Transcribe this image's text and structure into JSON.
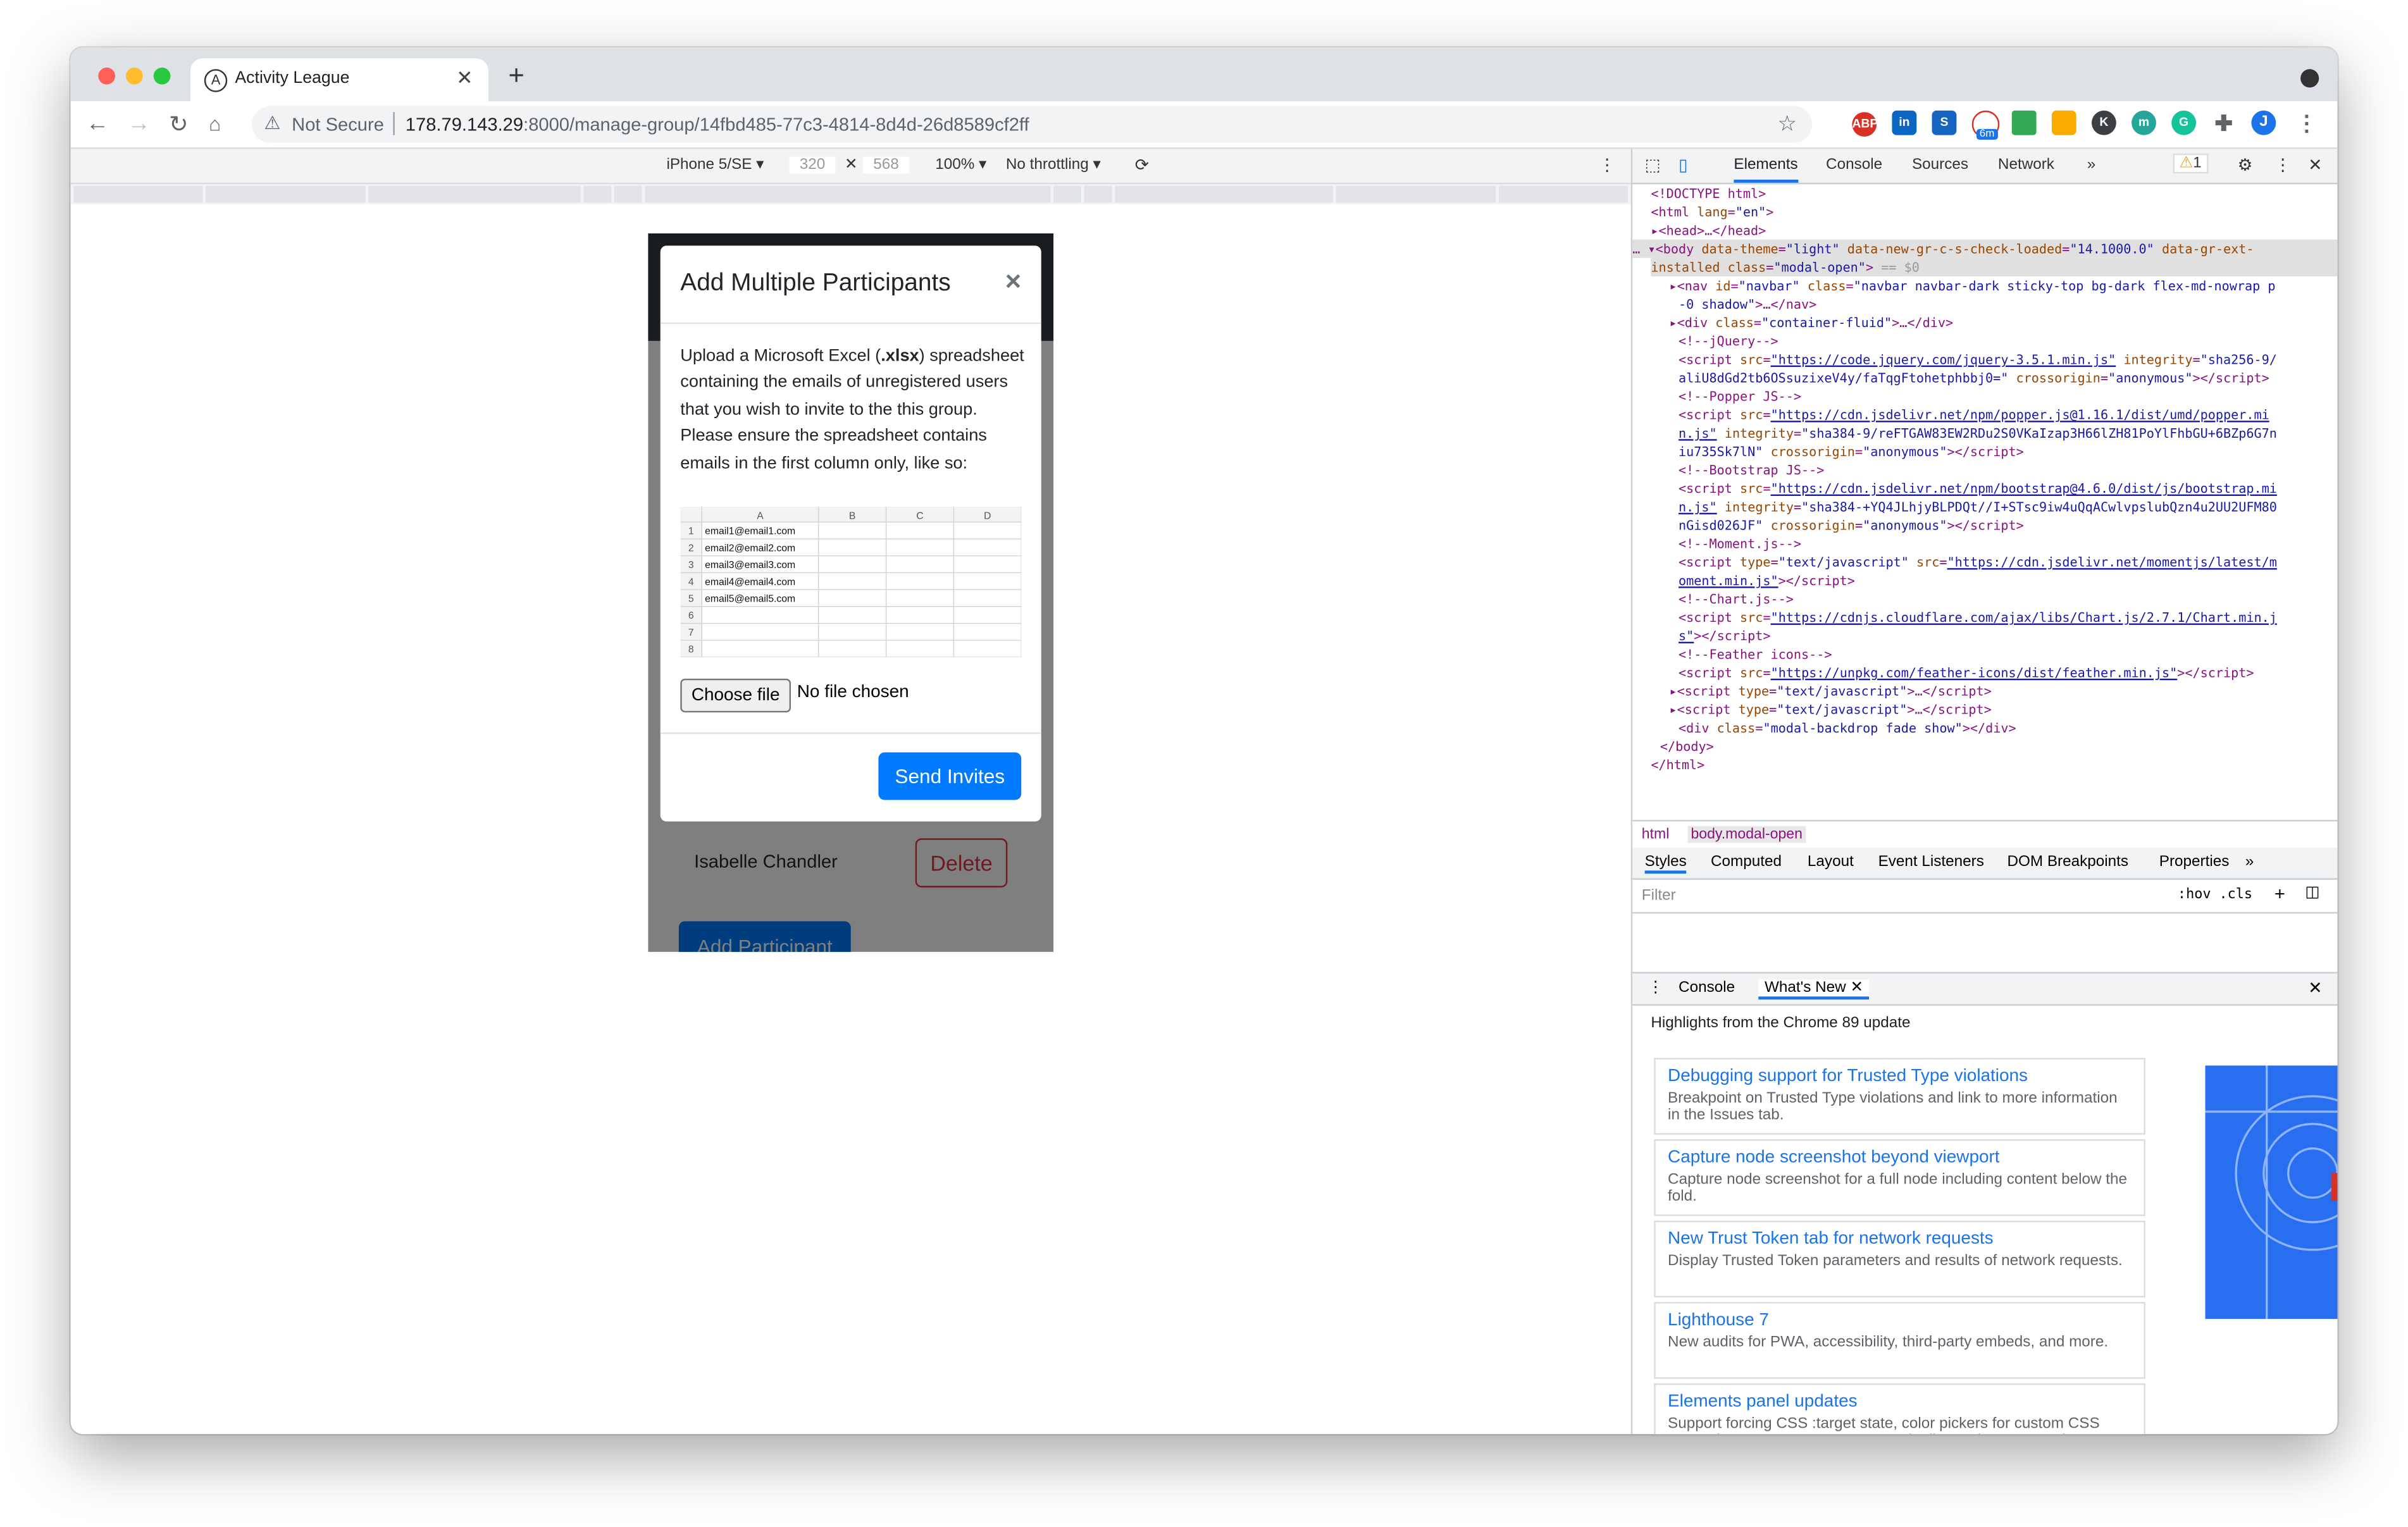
{
  "browser": {
    "tab_title": "Activity League",
    "tab_favicon_letter": "A",
    "not_secure_label": "Not Secure",
    "url_host": "178.79.143.29",
    "url_path": ":8000/manage-group/14fbd485-77c3-4814-8d4d-26d8589cf2ff",
    "profile_initial": "J",
    "ext_badge": "6m"
  },
  "device_toolbar": {
    "device": "iPhone 5/SE ▾",
    "width": "320",
    "height": "568",
    "zoom": "100% ▾",
    "throttling": "No throttling ▾"
  },
  "page": {
    "participant_name": "Isabelle Chandler",
    "delete_label": "Delete",
    "add_participant_label": "Add Participant"
  },
  "modal": {
    "title": "Add Multiple Participants",
    "close_symbol": "×",
    "body_line1_pre": "Upload a Microsoft Excel (",
    "body_line1_bold": ".xlsx",
    "body_line1_post": ") spreadsheet containing the emails of unregistered users that you wish to invite to the this group.",
    "body_line2": "Please ensure the spreadsheet contains emails in the first column only, like so:",
    "spreadsheet": {
      "columns": [
        "A",
        "B",
        "C",
        "D"
      ],
      "row_numbers": [
        "1",
        "2",
        "3",
        "4",
        "5",
        "6",
        "7",
        "8"
      ],
      "emails": [
        "email1@email1.com",
        "email2@email2.com",
        "email3@email3.com",
        "email4@email4.com",
        "email5@email5.com"
      ]
    },
    "choose_file_label": "Choose file",
    "no_file_label": "No file chosen",
    "send_label": "Send Invites"
  },
  "devtools": {
    "tabs": [
      "Elements",
      "Console",
      "Sources",
      "Network",
      "»"
    ],
    "warning_count": "1",
    "breadcrumbs": [
      "html",
      "body.modal-open"
    ],
    "style_tabs": [
      "Styles",
      "Computed",
      "Layout",
      "Event Listeners",
      "DOM Breakpoints",
      "Properties",
      "»"
    ],
    "filter_placeholder": "Filter",
    "hov_label": ":hov",
    "cls_label": ".cls",
    "drawer_tabs": [
      "Console",
      "What's New"
    ],
    "highlights": "Highlights from the Chrome 89 update",
    "cards": [
      {
        "title": "Debugging support for Trusted Type violations",
        "desc": "Breakpoint on Trusted Type violations and link to more information in the Issues tab."
      },
      {
        "title": "Capture node screenshot beyond viewport",
        "desc": "Capture node screenshot for a full node including content below the fold."
      },
      {
        "title": "New Trust Token tab for network requests",
        "desc": "Display Trusted Token parameters and results of network requests."
      },
      {
        "title": "Lighthouse 7",
        "desc": "New audits for PWA, accessibility, third-party embeds, and more."
      },
      {
        "title": "Elements panel updates",
        "desc": "Support forcing CSS :target state, color pickers for custom CSS properties, a new context menu to duplicate elements, and more."
      }
    ]
  },
  "colors": {
    "primary": "#007bff",
    "danger": "#dc3545",
    "devtools_link": "#1a73e8"
  }
}
